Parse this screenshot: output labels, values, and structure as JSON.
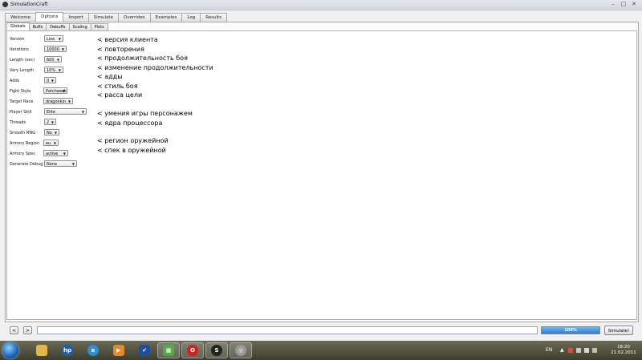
{
  "window": {
    "title": "SimulationCraft"
  },
  "main_tabs": [
    {
      "label": "Welcome"
    },
    {
      "label": "Options"
    },
    {
      "label": "Import"
    },
    {
      "label": "Simulate"
    },
    {
      "label": "Overrides"
    },
    {
      "label": "Examples"
    },
    {
      "label": "Log"
    },
    {
      "label": "Results"
    }
  ],
  "active_main_tab": "Options",
  "sub_tabs": [
    {
      "label": "Globals"
    },
    {
      "label": "Buffs"
    },
    {
      "label": "Debuffs"
    },
    {
      "label": "Scaling"
    },
    {
      "label": "Plots"
    }
  ],
  "active_sub_tab": "Globals",
  "options": [
    {
      "label": "Version",
      "value": "Live"
    },
    {
      "label": "Iterations",
      "value": "10000"
    },
    {
      "label": "Length (sec)",
      "value": "600"
    },
    {
      "label": "Vary Length",
      "value": "10%"
    },
    {
      "label": "Adds",
      "value": "0"
    },
    {
      "label": "Fight Style",
      "value": "Patchwerk"
    },
    {
      "label": "Target Race",
      "value": "dragonkin"
    },
    {
      "label": "Player Skill",
      "value": "Elite"
    },
    {
      "label": "Threads",
      "value": "2"
    },
    {
      "label": "Smooth RNG",
      "value": "No"
    },
    {
      "label": "Armory Region",
      "value": "eu"
    },
    {
      "label": "Armory Spec",
      "value": "active"
    },
    {
      "label": "Generate Debug",
      "value": "None"
    }
  ],
  "notes": [
    "< версия клиента",
    "< повторения",
    "< продолжительность боя",
    "< изменение продолжительности",
    "< адды",
    "< стиль боя",
    "< расса цели",
    "< умения игры персонажем",
    "< ядра процессора",
    "< регион оружейной",
    "< спек в оружейной"
  ],
  "bottom": {
    "back_label": "<",
    "forward_label": ">",
    "command_value": "",
    "progress_text": "100%",
    "progress_fraction": 1.0,
    "simulate_label": "Simulate!"
  },
  "taskbar": {
    "language": "EN",
    "time": "18:20",
    "date": "21.02.2011",
    "apps": [
      {
        "name": "windows-explorer-icon"
      },
      {
        "name": "hp-icon"
      },
      {
        "name": "internet-explorer-icon"
      },
      {
        "name": "media-player-icon"
      },
      {
        "name": "checkmark-app-icon"
      },
      {
        "name": "green-app-icon"
      },
      {
        "name": "opera-icon"
      },
      {
        "name": "simulationcraft-icon"
      },
      {
        "name": "gray-app-icon"
      }
    ]
  },
  "colors": {
    "progress": "#2f7fd0",
    "taskbar": "#4a4a38",
    "desktop": "#d8c46a"
  }
}
